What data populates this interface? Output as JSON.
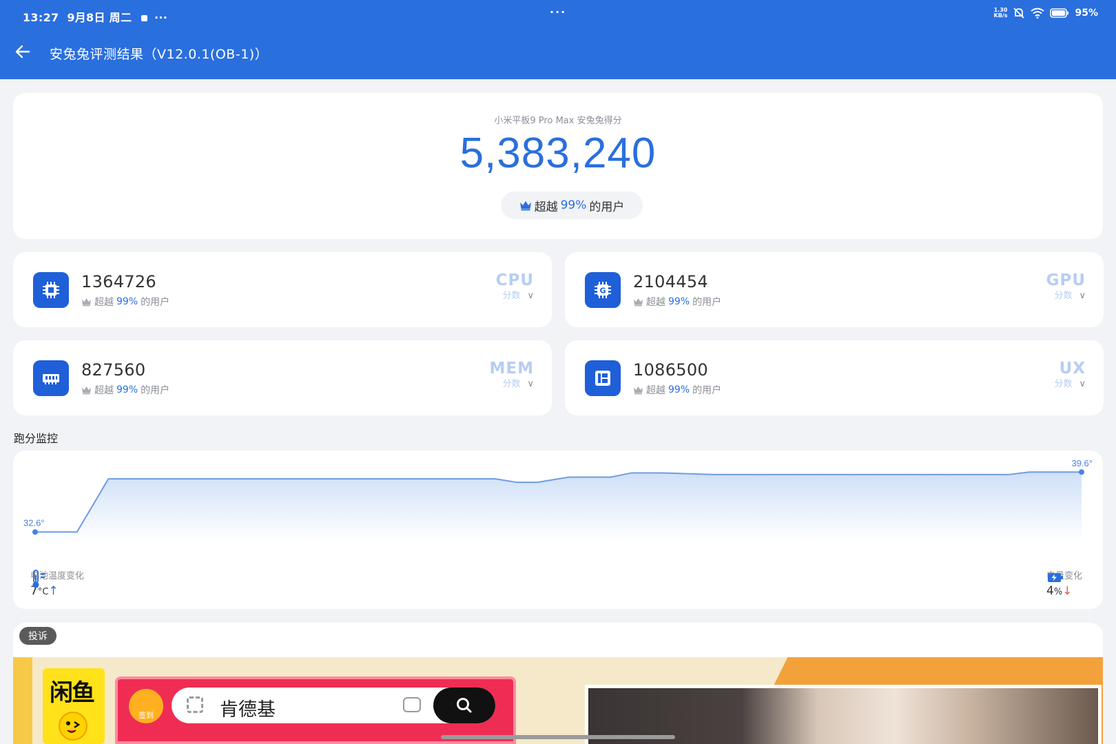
{
  "status_bar": {
    "time": "13:27",
    "date": "9月8日 周二",
    "more": "···",
    "center_dots": "···",
    "net_speed_value": "1.30",
    "net_speed_unit": "KB/s",
    "battery": "95%"
  },
  "header": {
    "title": "安兔兔评测结果（V12.0.1(OB-1)）"
  },
  "total": {
    "device_label": "小米平板9 Pro Max 安兔兔得分",
    "score": "5,383,240",
    "rank_prefix": "超越",
    "rank_percent": "99%",
    "rank_suffix": "的用户"
  },
  "scores": [
    {
      "value": "1364726",
      "rank_prefix": "超越",
      "rank_percent": "99%",
      "rank_suffix": "的用户",
      "tag": "CPU",
      "tag_sub": "分数",
      "chevron": "∨",
      "icon": "cpu-chip-icon"
    },
    {
      "value": "2104454",
      "rank_prefix": "超越",
      "rank_percent": "99%",
      "rank_suffix": "的用户",
      "tag": "GPU",
      "tag_sub": "分数",
      "chevron": "∨",
      "icon": "gpu-chip-icon"
    },
    {
      "value": "827560",
      "rank_prefix": "超越",
      "rank_percent": "99%",
      "rank_suffix": "的用户",
      "tag": "MEM",
      "tag_sub": "分数",
      "chevron": "∨",
      "icon": "memory-icon"
    },
    {
      "value": "1086500",
      "rank_prefix": "超越",
      "rank_percent": "99%",
      "rank_suffix": "的用户",
      "tag": "UX",
      "tag_sub": "分数",
      "chevron": "∨",
      "icon": "ux-layout-icon"
    }
  ],
  "monitor": {
    "section_title": "跑分监控",
    "start_label": "32.6°",
    "end_label": "39.6°",
    "temp_label": "电池温度变化",
    "temp_value": "7",
    "temp_unit": "°C",
    "temp_arrow": "↑",
    "battery_label": "电量变化",
    "battery_value": "4",
    "battery_unit": "%",
    "battery_arrow": "↓"
  },
  "chart_data": {
    "type": "area",
    "title": "",
    "xlabel": "",
    "ylabel": "",
    "x": [
      0,
      4,
      7,
      15,
      25,
      35,
      44,
      46,
      48,
      51,
      55,
      57,
      60,
      65,
      75,
      85,
      93,
      95,
      100
    ],
    "series": [
      {
        "values": [
          32.6,
          32.6,
          38.8,
          38.8,
          38.8,
          38.8,
          38.8,
          38.4,
          38.4,
          39.0,
          39.0,
          39.5,
          39.5,
          39.3,
          39.3,
          39.3,
          39.3,
          39.6,
          39.6
        ]
      }
    ],
    "ylim": [
      31.5,
      40.5
    ],
    "grid": false,
    "annotations": [
      "32.6°",
      "39.6°"
    ]
  },
  "ad": {
    "complain_label": "投诉",
    "logo_text": "闲鱼",
    "sign_label": "签到",
    "search_text": "肯德基"
  },
  "colors": {
    "primary": "#2a6fde",
    "icon_bg": "#1f5fd8",
    "tag": "#b7cdf3",
    "down": "#e05a4a"
  }
}
